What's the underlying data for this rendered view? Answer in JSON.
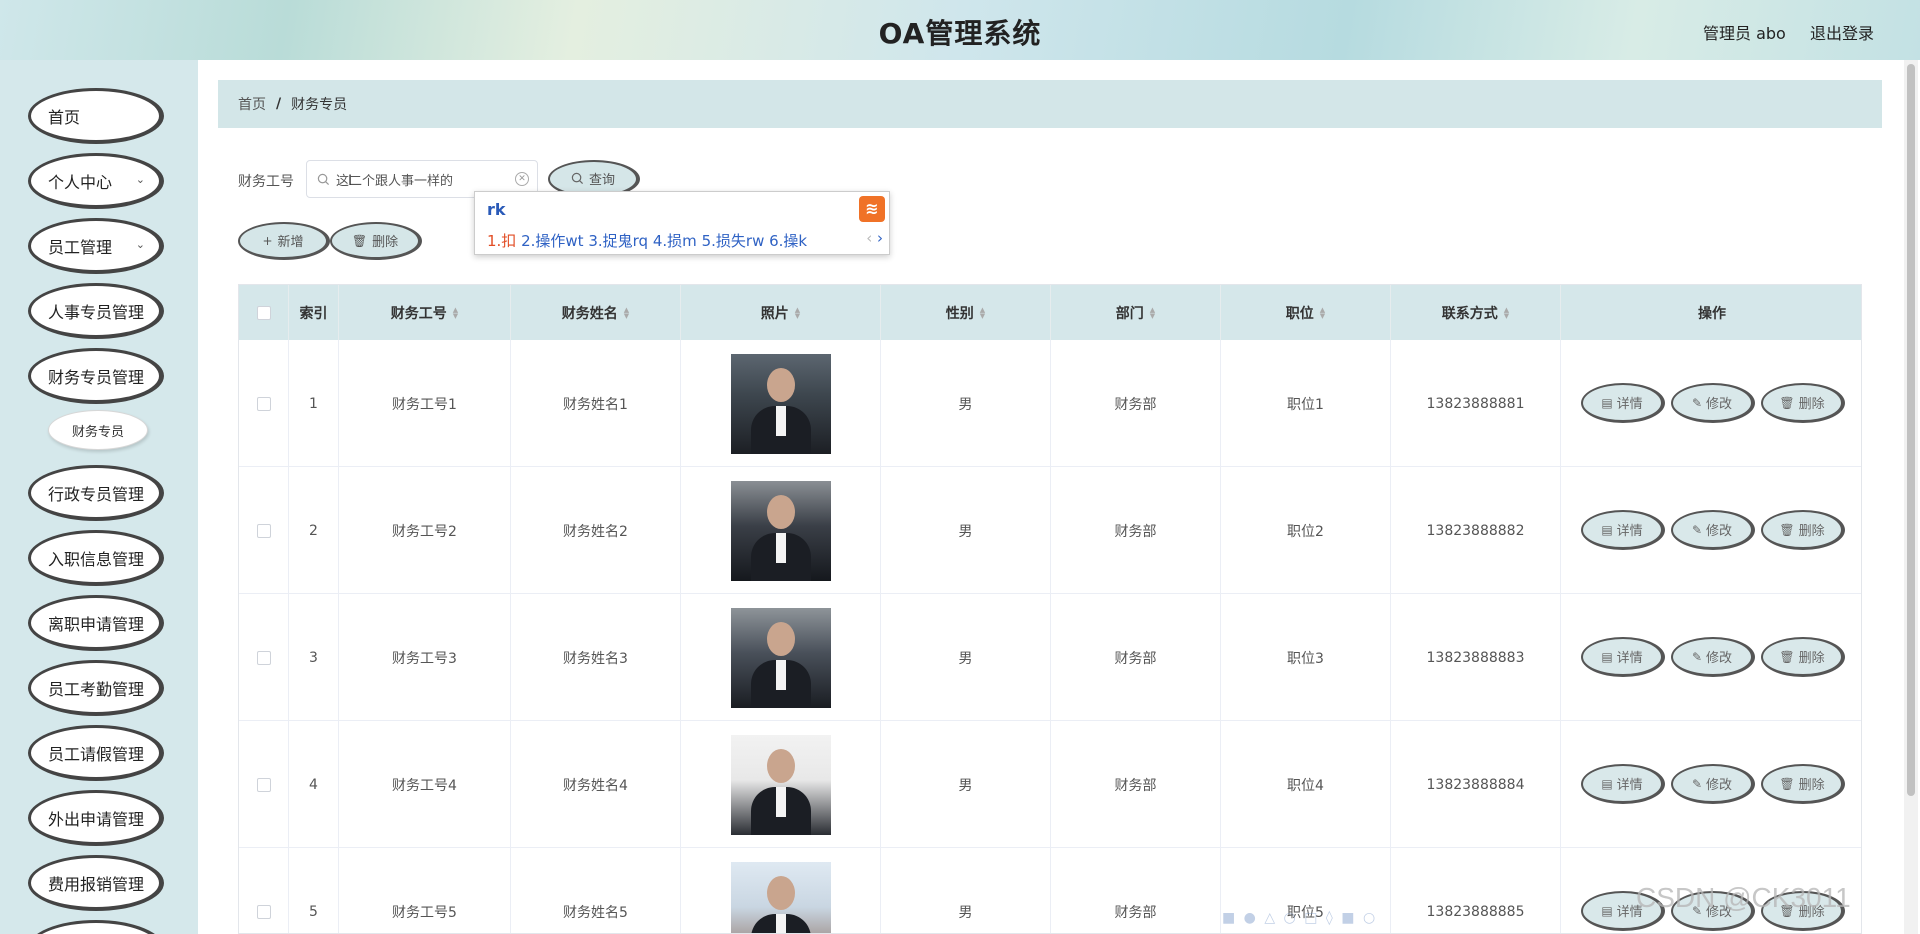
{
  "header": {
    "title": "OA管理系统",
    "user": "管理员 abo",
    "logout": "退出登录"
  },
  "sidebar": {
    "items": [
      {
        "label": "首页",
        "chevron": false
      },
      {
        "label": "个人中心",
        "chevron": true
      },
      {
        "label": "员工管理",
        "chevron": true
      },
      {
        "label": "人事专员管理",
        "chevron": false
      },
      {
        "label": "财务专员管理",
        "chevron": false
      },
      {
        "label": "行政专员管理",
        "chevron": false
      },
      {
        "label": "入职信息管理",
        "chevron": false
      },
      {
        "label": "离职申请管理",
        "chevron": false
      },
      {
        "label": "员工考勤管理",
        "chevron": false
      },
      {
        "label": "员工请假管理",
        "chevron": false
      },
      {
        "label": "外出申请管理",
        "chevron": false
      },
      {
        "label": "费用报销管理",
        "chevron": false
      }
    ],
    "sub_item": "财务专员"
  },
  "breadcrumb": {
    "home": "首页",
    "separator": "/",
    "current": "财务专员"
  },
  "search": {
    "label": "财务工号",
    "value": "这二个跟人事一样的",
    "button": "查询"
  },
  "toolbar": {
    "add": "新增",
    "delete": "删除"
  },
  "ime": {
    "input": "rk",
    "candidates": [
      "1.扣",
      "2.操作wt",
      "3.捉鬼rq",
      "4.损m",
      "5.损失rw",
      "6.操k"
    ]
  },
  "table": {
    "columns": [
      "索引",
      "财务工号",
      "财务姓名",
      "照片",
      "性别",
      "部门",
      "职位",
      "联系方式",
      "操作"
    ],
    "rows": [
      {
        "index": "1",
        "id": "财务工号1",
        "name": "财务姓名1",
        "gender": "男",
        "dept": "财务部",
        "position": "职位1",
        "phone": "13823888881"
      },
      {
        "index": "2",
        "id": "财务工号2",
        "name": "财务姓名2",
        "gender": "男",
        "dept": "财务部",
        "position": "职位2",
        "phone": "13823888882"
      },
      {
        "index": "3",
        "id": "财务工号3",
        "name": "财务姓名3",
        "gender": "男",
        "dept": "财务部",
        "position": "职位3",
        "phone": "13823888883"
      },
      {
        "index": "4",
        "id": "财务工号4",
        "name": "财务姓名4",
        "gender": "男",
        "dept": "财务部",
        "position": "职位4",
        "phone": "13823888884"
      },
      {
        "index": "5",
        "id": "财务工号5",
        "name": "财务姓名5",
        "gender": "男",
        "dept": "财务部",
        "position": "职位5",
        "phone": "13823888885"
      }
    ],
    "actions": {
      "detail": "详情",
      "edit": "修改",
      "delete": "删除"
    }
  },
  "watermark": "CSDN @CK3011"
}
